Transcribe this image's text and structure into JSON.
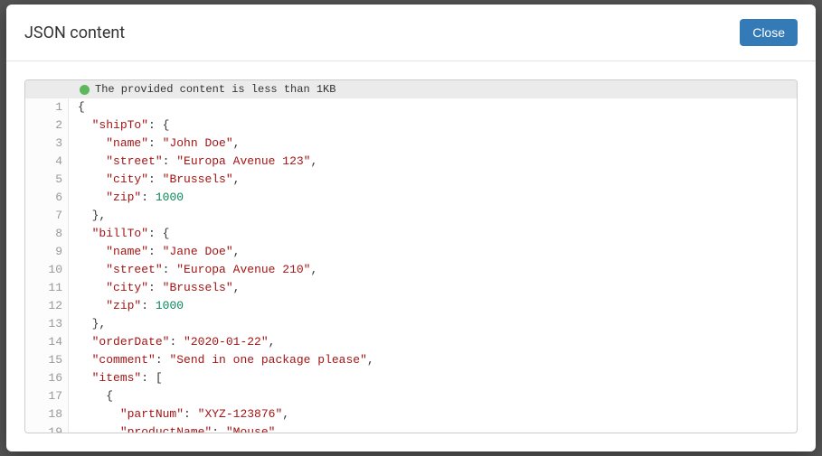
{
  "modal": {
    "title": "JSON content",
    "close_label": "Close",
    "status_message": "The provided content is less than 1KB"
  },
  "code": {
    "lines": [
      {
        "n": 1,
        "tokens": [
          {
            "t": "{",
            "c": "punc"
          }
        ]
      },
      {
        "n": 2,
        "tokens": [
          {
            "t": "  ",
            "c": "punc"
          },
          {
            "t": "\"shipTo\"",
            "c": "key"
          },
          {
            "t": ": {",
            "c": "punc"
          }
        ]
      },
      {
        "n": 3,
        "tokens": [
          {
            "t": "    ",
            "c": "punc"
          },
          {
            "t": "\"name\"",
            "c": "key"
          },
          {
            "t": ": ",
            "c": "punc"
          },
          {
            "t": "\"John Doe\"",
            "c": "str"
          },
          {
            "t": ",",
            "c": "punc"
          }
        ]
      },
      {
        "n": 4,
        "tokens": [
          {
            "t": "    ",
            "c": "punc"
          },
          {
            "t": "\"street\"",
            "c": "key"
          },
          {
            "t": ": ",
            "c": "punc"
          },
          {
            "t": "\"Europa Avenue 123\"",
            "c": "str"
          },
          {
            "t": ",",
            "c": "punc"
          }
        ]
      },
      {
        "n": 5,
        "tokens": [
          {
            "t": "    ",
            "c": "punc"
          },
          {
            "t": "\"city\"",
            "c": "key"
          },
          {
            "t": ": ",
            "c": "punc"
          },
          {
            "t": "\"Brussels\"",
            "c": "str"
          },
          {
            "t": ",",
            "c": "punc"
          }
        ]
      },
      {
        "n": 6,
        "tokens": [
          {
            "t": "    ",
            "c": "punc"
          },
          {
            "t": "\"zip\"",
            "c": "key"
          },
          {
            "t": ": ",
            "c": "punc"
          },
          {
            "t": "1000",
            "c": "num"
          }
        ]
      },
      {
        "n": 7,
        "tokens": [
          {
            "t": "  },",
            "c": "punc"
          }
        ]
      },
      {
        "n": 8,
        "tokens": [
          {
            "t": "  ",
            "c": "punc"
          },
          {
            "t": "\"billTo\"",
            "c": "key"
          },
          {
            "t": ": {",
            "c": "punc"
          }
        ]
      },
      {
        "n": 9,
        "tokens": [
          {
            "t": "    ",
            "c": "punc"
          },
          {
            "t": "\"name\"",
            "c": "key"
          },
          {
            "t": ": ",
            "c": "punc"
          },
          {
            "t": "\"Jane Doe\"",
            "c": "str"
          },
          {
            "t": ",",
            "c": "punc"
          }
        ]
      },
      {
        "n": 10,
        "tokens": [
          {
            "t": "    ",
            "c": "punc"
          },
          {
            "t": "\"street\"",
            "c": "key"
          },
          {
            "t": ": ",
            "c": "punc"
          },
          {
            "t": "\"Europa Avenue 210\"",
            "c": "str"
          },
          {
            "t": ",",
            "c": "punc"
          }
        ]
      },
      {
        "n": 11,
        "tokens": [
          {
            "t": "    ",
            "c": "punc"
          },
          {
            "t": "\"city\"",
            "c": "key"
          },
          {
            "t": ": ",
            "c": "punc"
          },
          {
            "t": "\"Brussels\"",
            "c": "str"
          },
          {
            "t": ",",
            "c": "punc"
          }
        ]
      },
      {
        "n": 12,
        "tokens": [
          {
            "t": "    ",
            "c": "punc"
          },
          {
            "t": "\"zip\"",
            "c": "key"
          },
          {
            "t": ": ",
            "c": "punc"
          },
          {
            "t": "1000",
            "c": "num"
          }
        ]
      },
      {
        "n": 13,
        "tokens": [
          {
            "t": "  },",
            "c": "punc"
          }
        ]
      },
      {
        "n": 14,
        "tokens": [
          {
            "t": "  ",
            "c": "punc"
          },
          {
            "t": "\"orderDate\"",
            "c": "key"
          },
          {
            "t": ": ",
            "c": "punc"
          },
          {
            "t": "\"2020-01-22\"",
            "c": "str"
          },
          {
            "t": ",",
            "c": "punc"
          }
        ]
      },
      {
        "n": 15,
        "tokens": [
          {
            "t": "  ",
            "c": "punc"
          },
          {
            "t": "\"comment\"",
            "c": "key"
          },
          {
            "t": ": ",
            "c": "punc"
          },
          {
            "t": "\"Send in one package please\"",
            "c": "str"
          },
          {
            "t": ",",
            "c": "punc"
          }
        ]
      },
      {
        "n": 16,
        "tokens": [
          {
            "t": "  ",
            "c": "punc"
          },
          {
            "t": "\"items\"",
            "c": "key"
          },
          {
            "t": ": [",
            "c": "punc"
          }
        ]
      },
      {
        "n": 17,
        "tokens": [
          {
            "t": "    {",
            "c": "punc"
          }
        ]
      },
      {
        "n": 18,
        "tokens": [
          {
            "t": "      ",
            "c": "punc"
          },
          {
            "t": "\"partNum\"",
            "c": "key"
          },
          {
            "t": ": ",
            "c": "punc"
          },
          {
            "t": "\"XYZ-123876\"",
            "c": "str"
          },
          {
            "t": ",",
            "c": "punc"
          }
        ]
      },
      {
        "n": 19,
        "tokens": [
          {
            "t": "      ",
            "c": "punc"
          },
          {
            "t": "\"productName\"",
            "c": "key"
          },
          {
            "t": ": ",
            "c": "punc"
          },
          {
            "t": "\"Mouse\"",
            "c": "str"
          },
          {
            "t": ",",
            "c": "punc"
          }
        ]
      }
    ]
  }
}
